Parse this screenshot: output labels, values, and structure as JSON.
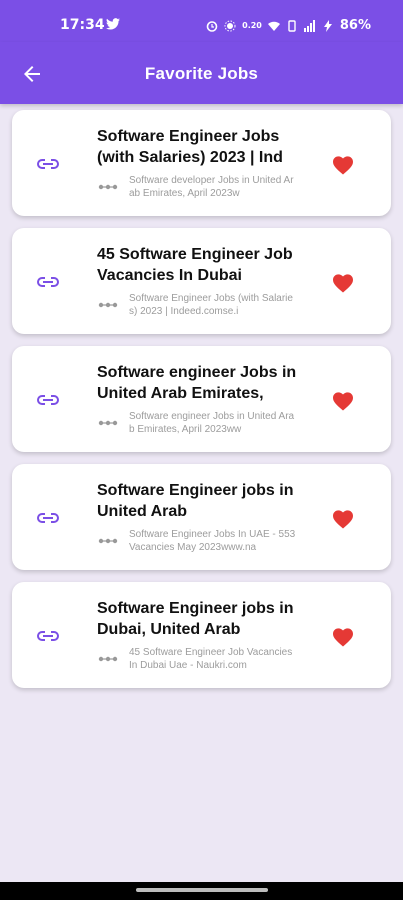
{
  "status_bar": {
    "time": "17:34",
    "speed": "0.20",
    "battery": "86%"
  },
  "app_bar": {
    "title": "Favorite Jobs"
  },
  "colors": {
    "primary": "#7b4fe6",
    "heart": "#e53935",
    "background": "#ece7f4"
  },
  "favorites": [
    {
      "title": "Software Engineer Jobs (with Salaries) 2023 | Ind",
      "description": "Software developer Jobs in United Arab Emirates, April 2023w"
    },
    {
      "title": "45 Software Engineer Job Vacancies In Dubai",
      "description": "Software Engineer Jobs (with Salaries) 2023 | Indeed.comse.i"
    },
    {
      "title": "Software engineer Jobs in United Arab Emirates,",
      "description": "Software engineer Jobs in United Arab Emirates, April 2023ww"
    },
    {
      "title": "Software Engineer jobs in United Arab",
      "description": "Software Engineer Jobs In UAE - 553 Vacancies May 2023www.na"
    },
    {
      "title": "Software Engineer jobs in Dubai, United Arab",
      "description": "45 Software Engineer Job Vacancies In Dubai Uae - Naukri.com"
    }
  ],
  "icons": {
    "back": "arrow-back-icon",
    "link": "link-icon",
    "more": "more-dots-icon",
    "favorite": "heart-icon"
  }
}
